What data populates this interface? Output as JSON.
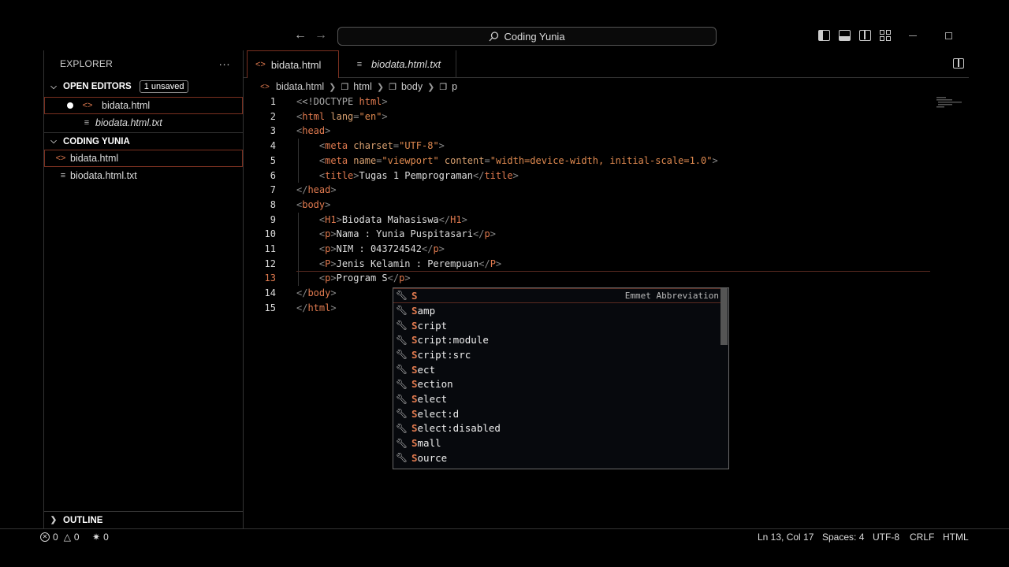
{
  "titlebar": {
    "search_text": "Coding Yunia",
    "back_icon": "arrow-left-icon",
    "forward_icon": "arrow-right-icon"
  },
  "sidebar": {
    "title": "EXPLORER",
    "more": "···",
    "open_editors": {
      "label": "OPEN EDITORS",
      "badge": "1 unsaved",
      "items": [
        {
          "name": "bidata.html",
          "unsaved": true
        },
        {
          "name": "biodata.html.txt",
          "italic": true
        }
      ]
    },
    "folder": {
      "label": "CODING YUNIA",
      "items": [
        {
          "name": "bidata.html"
        },
        {
          "name": "biodata.html.txt"
        }
      ]
    },
    "outline": "OUTLINE"
  },
  "tabs": [
    {
      "label": "bidata.html",
      "active": true,
      "unsaved": true
    },
    {
      "label": "biodata.html.txt",
      "italic": true
    }
  ],
  "breadcrumb": [
    "bidata.html",
    "html",
    "body",
    "p"
  ],
  "code_lines": [
    {
      "n": "1"
    },
    {
      "n": "2"
    },
    {
      "n": "3"
    },
    {
      "n": "4"
    },
    {
      "n": "5"
    },
    {
      "n": "6"
    },
    {
      "n": "7"
    },
    {
      "n": "8"
    },
    {
      "n": "9"
    },
    {
      "n": "10"
    },
    {
      "n": "11"
    },
    {
      "n": "12"
    },
    {
      "n": "13"
    },
    {
      "n": "14"
    },
    {
      "n": "15"
    }
  ],
  "code": {
    "l1_dt": "<!DOCTYPE",
    "l1_html": " html",
    "l1_close": ">",
    "l2_attr": "lang",
    "l2_val": "\"en\"",
    "l4_attr": "charset",
    "l4_val": "\"UTF-8\"",
    "l5_attr1": "name",
    "l5_val1": "\"viewport\"",
    "l5_attr2": "content",
    "l5_val2": "\"width=device-width, initial-scale=1.0\"",
    "l6_text": "Tugas 1 Pemprograman",
    "l9_text": "Biodata Mahasiswa",
    "l10_text": "Nama : Yunia Puspitasari",
    "l11_text": "NIM : 043724542",
    "l12_text": "Jenis Kelamin : Perempuan",
    "l13_text": "Program S"
  },
  "suggest": {
    "detail": "Emmet Abbreviation",
    "items": [
      {
        "hl": "S",
        "rest": ""
      },
      {
        "hl": "S",
        "rest": "amp"
      },
      {
        "hl": "S",
        "rest": "cript"
      },
      {
        "hl": "S",
        "rest": "cript:module"
      },
      {
        "hl": "S",
        "rest": "cript:src"
      },
      {
        "hl": "S",
        "rest": "ect"
      },
      {
        "hl": "S",
        "rest": "ection"
      },
      {
        "hl": "S",
        "rest": "elect"
      },
      {
        "hl": "S",
        "rest": "elect:d"
      },
      {
        "hl": "S",
        "rest": "elect:disabled"
      },
      {
        "hl": "S",
        "rest": "mall"
      },
      {
        "hl": "S",
        "rest": "ource"
      }
    ]
  },
  "status": {
    "errors": "0",
    "warnings": "0",
    "ports": "0",
    "position": "Ln 13, Col 17",
    "spaces": "Spaces: 4",
    "encoding": "UTF-8",
    "eol": "CRLF",
    "language": "HTML"
  },
  "colors": {
    "accent": "#e07a4f",
    "border_active": "#7a3020",
    "background": "#000000"
  }
}
